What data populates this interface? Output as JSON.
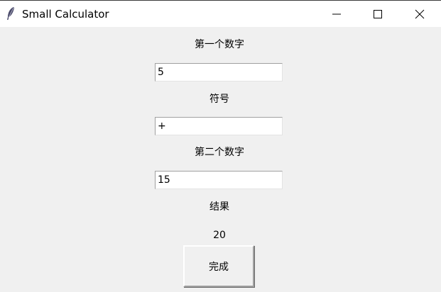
{
  "window": {
    "title": "Small Calculator",
    "app_icon": "feather-icon",
    "controls": {
      "minimize": "minimize-icon",
      "maximize": "maximize-icon",
      "close": "close-icon"
    }
  },
  "form": {
    "first_label": "第一个数字",
    "first_value": "5",
    "operator_label": "符号",
    "operator_value": "+",
    "second_label": "第二个数字",
    "second_value": "15",
    "result_label": "结果",
    "result_value": "20",
    "done_label": "完成"
  }
}
